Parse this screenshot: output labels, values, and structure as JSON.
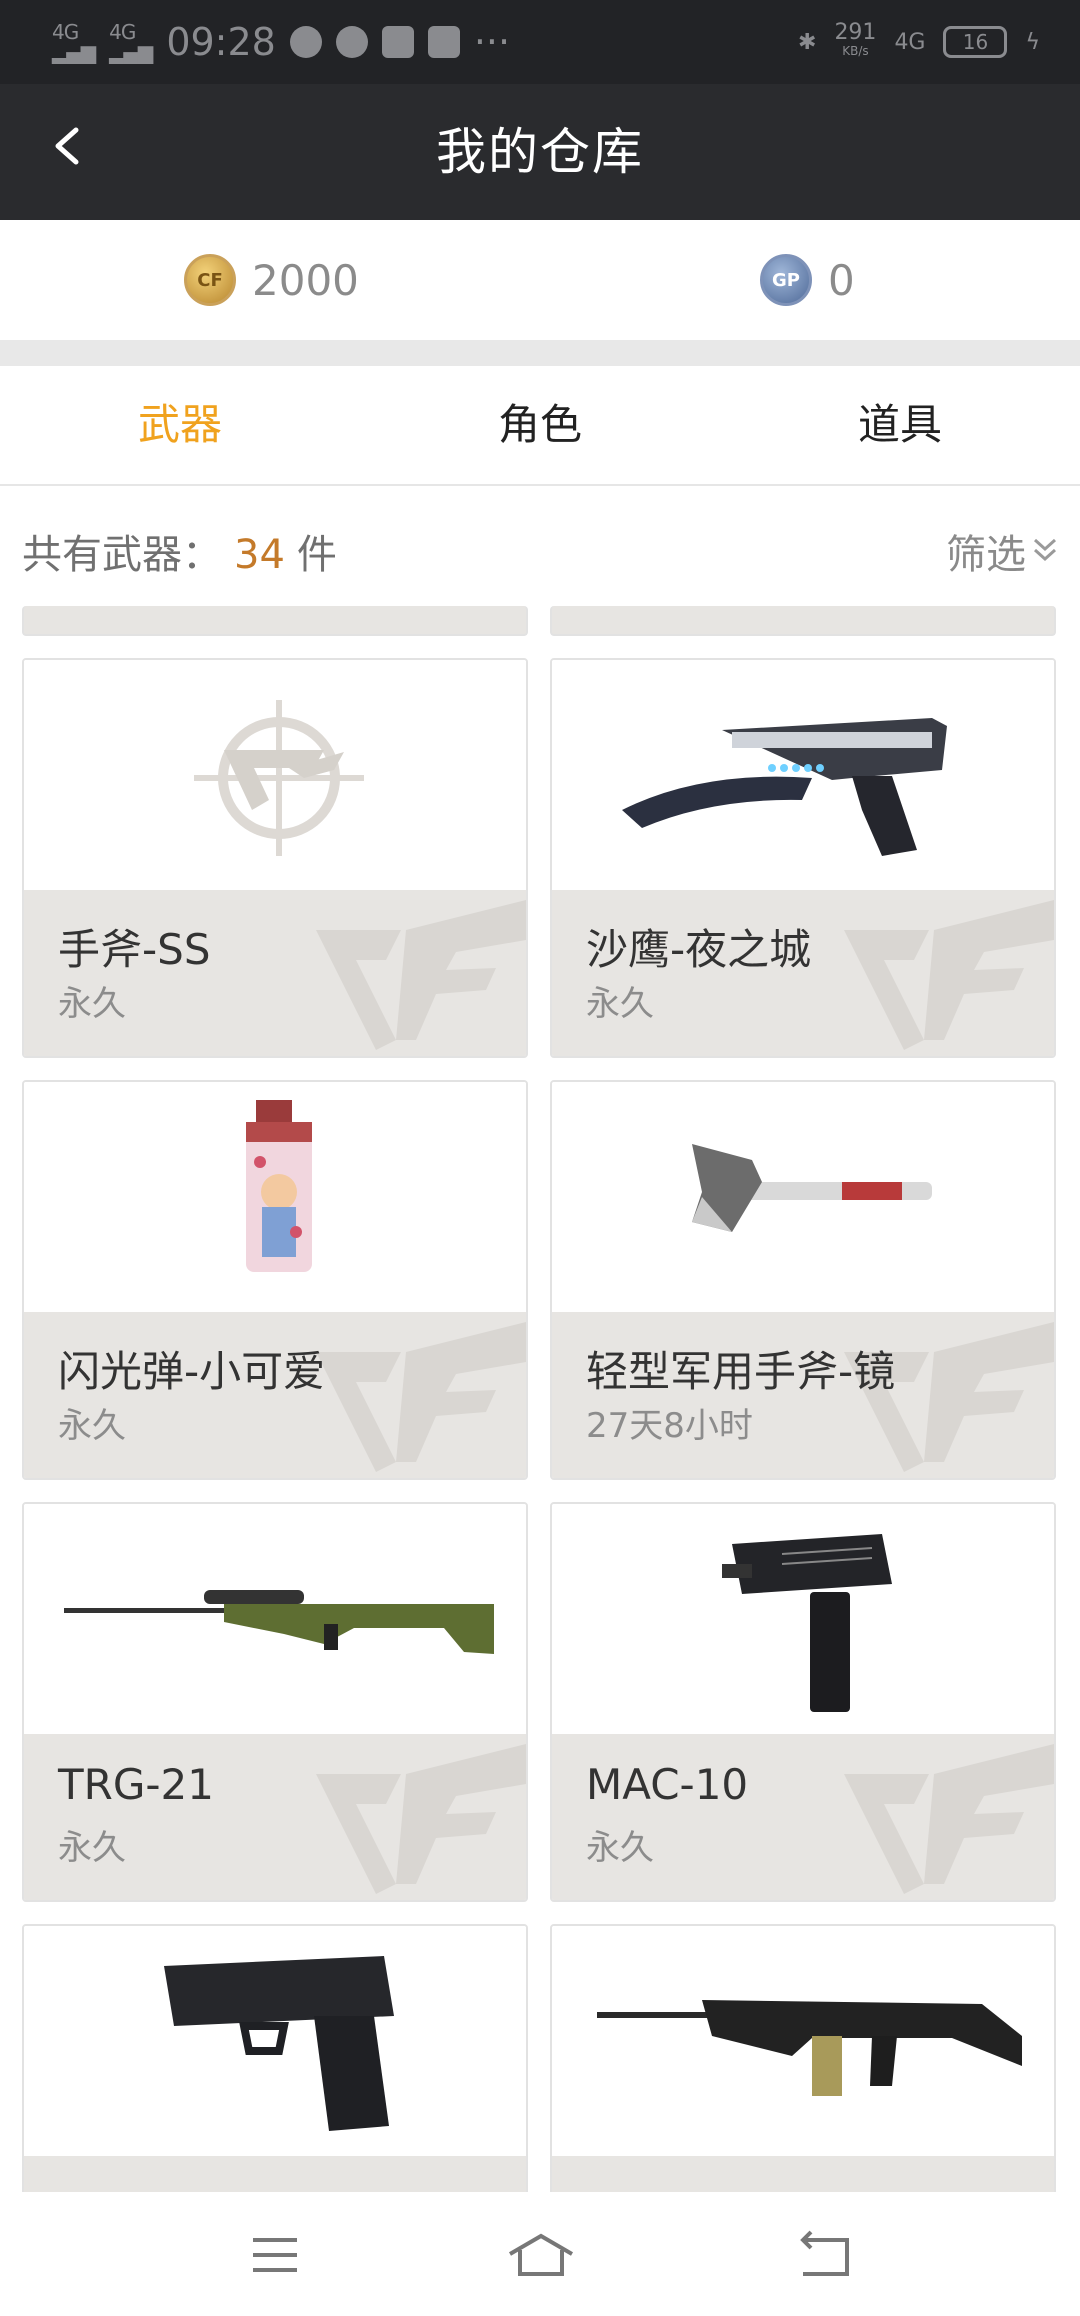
{
  "status_bar": {
    "time": "09:28",
    "signal": "4G",
    "speed": "291",
    "speed_unit": "KB/s",
    "network": "4G",
    "battery": "16",
    "more": "···"
  },
  "header": {
    "title": "我的仓库",
    "back_icon": "chevron-left-icon"
  },
  "currency": {
    "cf_coin_icon": "cf-coin-icon",
    "cf_amount": "2000",
    "gp_coin_label": "GP",
    "gp_amount": "0"
  },
  "tabs": [
    {
      "label": "武器",
      "active": true
    },
    {
      "label": "角色",
      "active": false
    },
    {
      "label": "道具",
      "active": false
    }
  ],
  "summary": {
    "prefix": "共有武器：",
    "count": "34",
    "suffix": "件",
    "filter_label": "筛选"
  },
  "items": [
    {
      "name": "手斧-SS",
      "duration": "永久",
      "image": "cf-logo-placeholder"
    },
    {
      "name": "沙鹰-夜之城",
      "duration": "永久",
      "image": "pistol-desert-eagle"
    },
    {
      "name": "闪光弹-小可爱",
      "duration": "永久",
      "image": "flash-grenade"
    },
    {
      "name": "轻型军用手斧-镜",
      "duration": "27天8小时",
      "image": "hatchet"
    },
    {
      "name": "TRG-21",
      "duration": "永久",
      "image": "sniper-rifle"
    },
    {
      "name": "MAC-10",
      "duration": "永久",
      "image": "smg"
    },
    {
      "name": "",
      "duration": "",
      "image": "pistol"
    },
    {
      "name": "",
      "duration": "",
      "image": "machine-gun"
    }
  ],
  "bottom_nav": [
    "menu-icon",
    "home-icon",
    "back-icon"
  ],
  "colors": {
    "accent": "#f0a21e",
    "count": "#c47a2a",
    "navbar": "#2a2b2e"
  }
}
